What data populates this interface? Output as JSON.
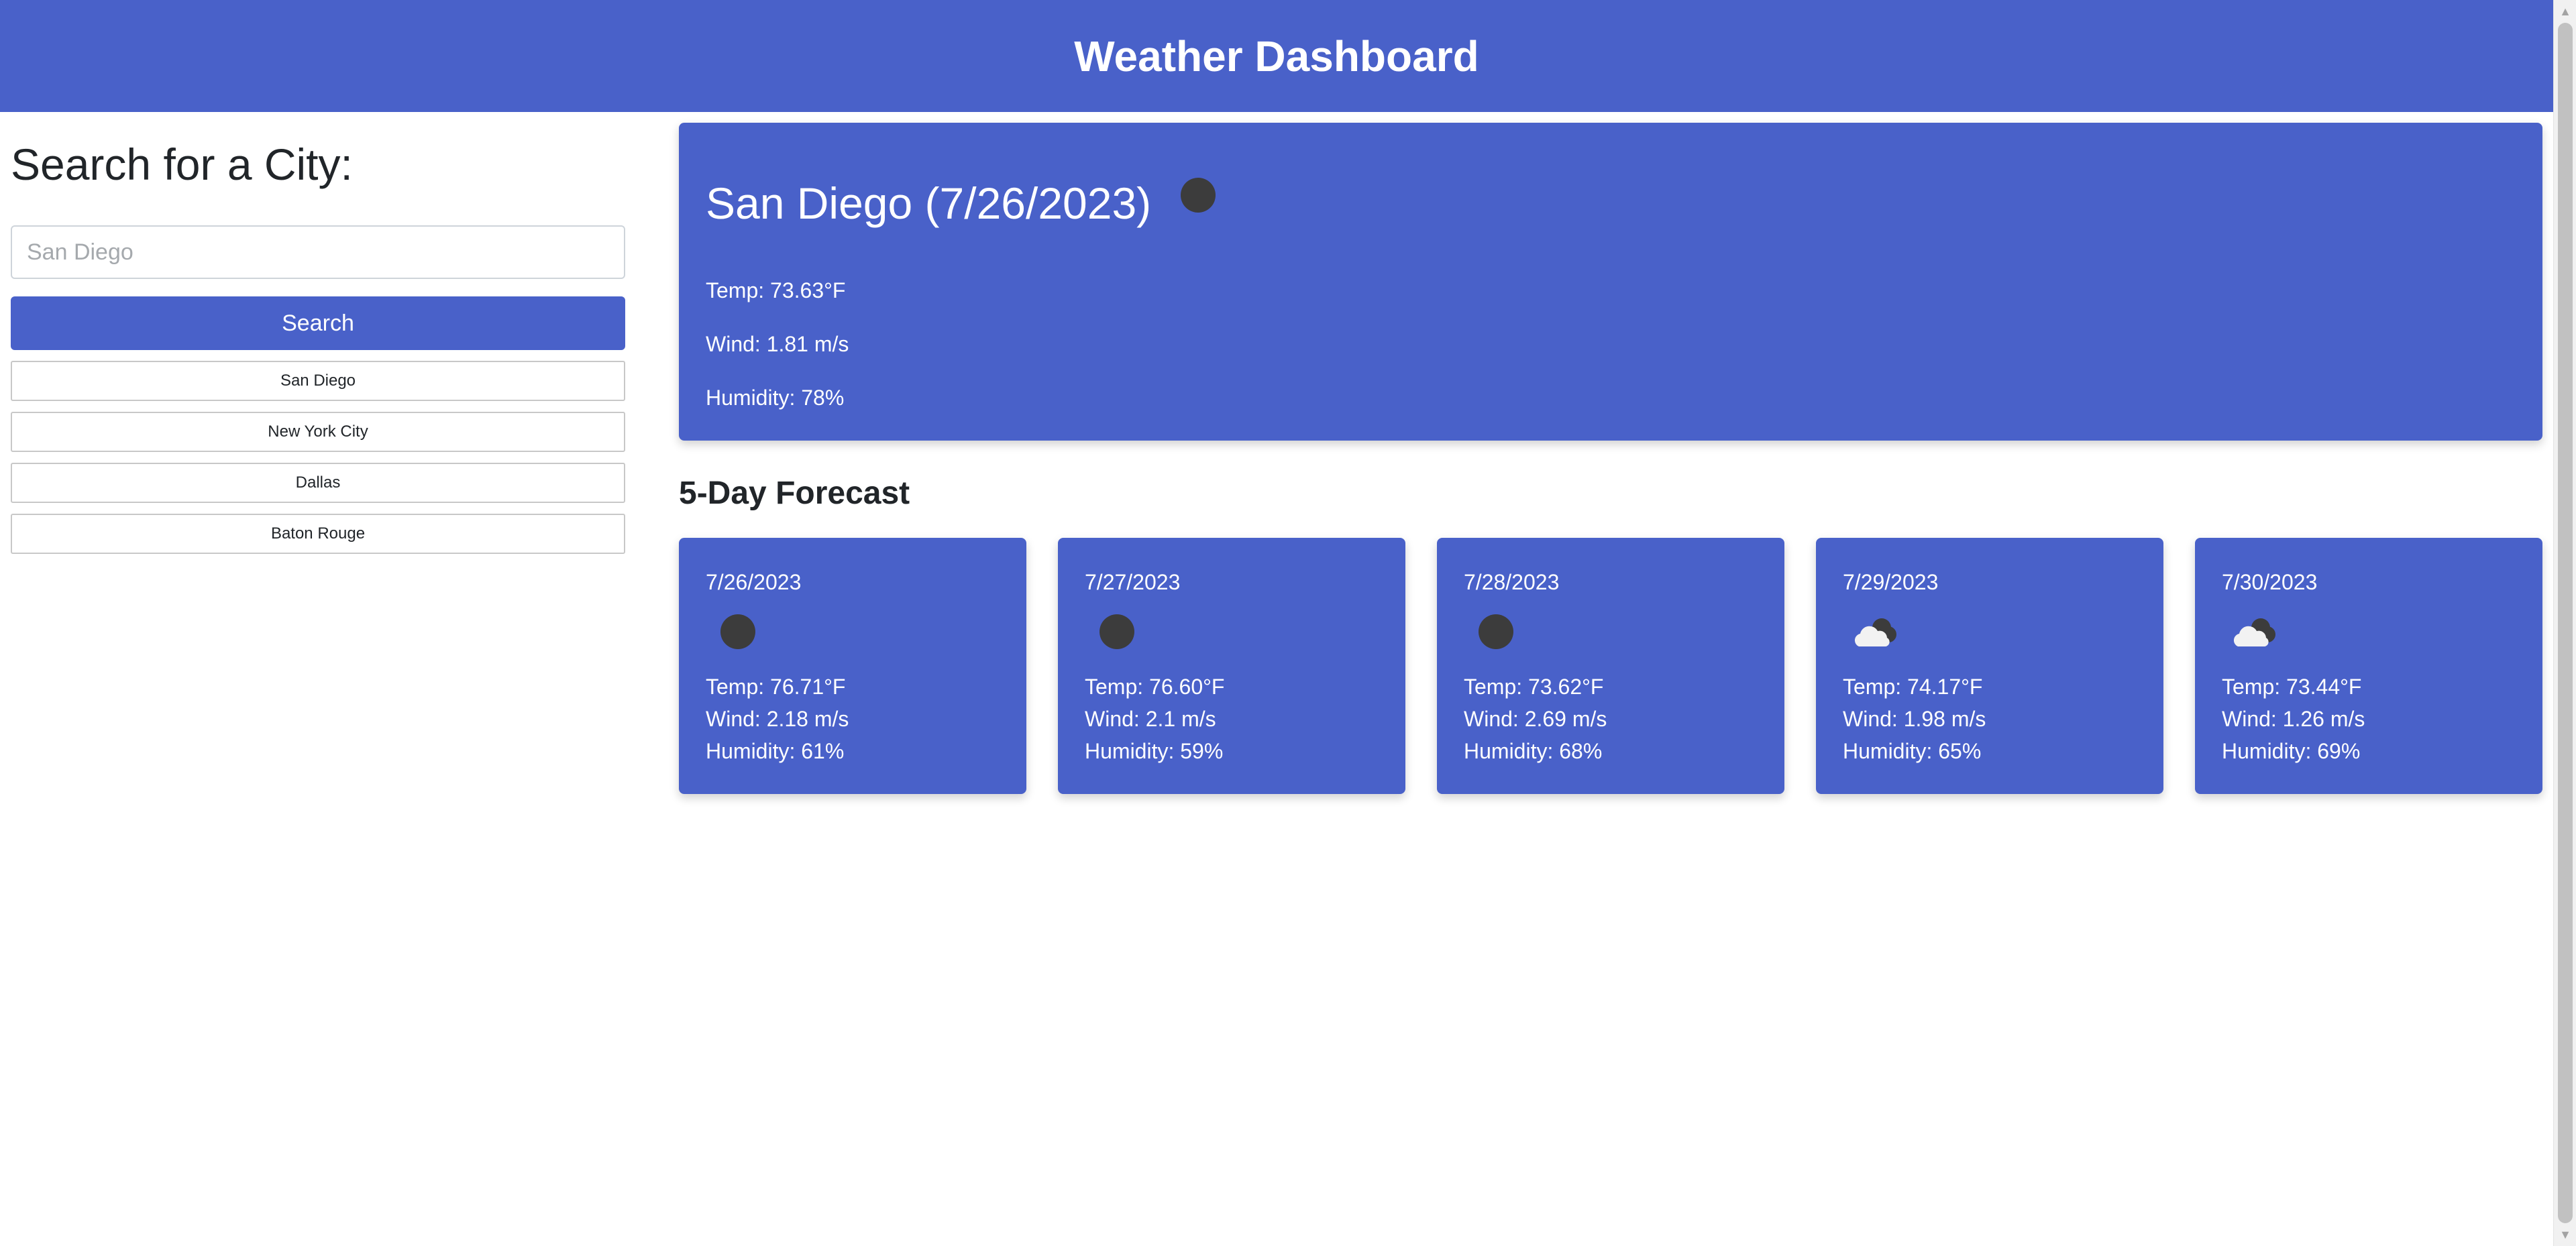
{
  "header": {
    "title": "Weather Dashboard"
  },
  "search": {
    "heading": "Search for a City:",
    "placeholder": "San Diego",
    "value": "",
    "button_label": "Search"
  },
  "history": [
    {
      "label": "San Diego"
    },
    {
      "label": "New York City"
    },
    {
      "label": "Dallas"
    },
    {
      "label": "Baton Rouge"
    }
  ],
  "current": {
    "title": "San Diego (7/26/2023)",
    "icon": "clear-night-icon",
    "temp": "Temp: 73.63°F",
    "wind": "Wind: 1.81 m/s",
    "humidity": "Humidity: 78%"
  },
  "forecast": {
    "heading": "5-Day Forecast",
    "days": [
      {
        "date": "7/26/2023",
        "icon": "clear-night-icon",
        "temp": "Temp: 76.71°F",
        "wind": "Wind: 2.18 m/s",
        "humidity": "Humidity: 61%"
      },
      {
        "date": "7/27/2023",
        "icon": "clear-night-icon",
        "temp": "Temp: 76.60°F",
        "wind": "Wind: 2.1 m/s",
        "humidity": "Humidity: 59%"
      },
      {
        "date": "7/28/2023",
        "icon": "clear-night-icon",
        "temp": "Temp: 73.62°F",
        "wind": "Wind: 2.69 m/s",
        "humidity": "Humidity: 68%"
      },
      {
        "date": "7/29/2023",
        "icon": "partly-cloudy-night-icon",
        "temp": "Temp: 74.17°F",
        "wind": "Wind: 1.98 m/s",
        "humidity": "Humidity: 65%"
      },
      {
        "date": "7/30/2023",
        "icon": "partly-cloudy-night-icon",
        "temp": "Temp: 73.44°F",
        "wind": "Wind: 1.26 m/s",
        "humidity": "Humidity: 69%"
      }
    ]
  },
  "colors": {
    "accent": "#4961c9",
    "text_dark": "#212529",
    "icon_dark": "#3c3c3c"
  }
}
